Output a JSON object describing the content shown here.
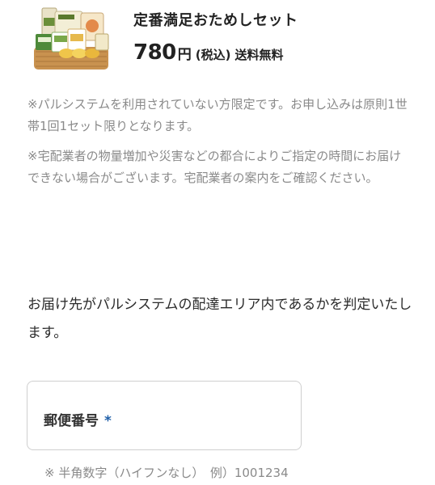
{
  "product": {
    "image_icon": "gift-set-basket-image",
    "title": "定番満足おためしセット",
    "price_amount": "780",
    "price_unit": "円",
    "tax_label": "(税込)",
    "shipping_label": "送料無料"
  },
  "notes": [
    "※パルシステムを利用されていない方限定です。お申し込みは原則1世帯1回1セット限りとなります。",
    "※宅配業者の物量増加や災害などの都合によりご指定の時間にお届けできない場合がございます。宅配業者の案内をご確認ください。"
  ],
  "intro_text": "お届け先がパルシステムの配達エリア内であるかを判定いたします。",
  "postal": {
    "label": "郵便番号",
    "required_mark": "*",
    "value": "",
    "hint": "※ 半角数字（ハイフンなし）　例）1001234"
  },
  "colors": {
    "required_mark": "#1f5fa8",
    "note_text": "#8a8a8a",
    "border": "#cfcfcf"
  }
}
